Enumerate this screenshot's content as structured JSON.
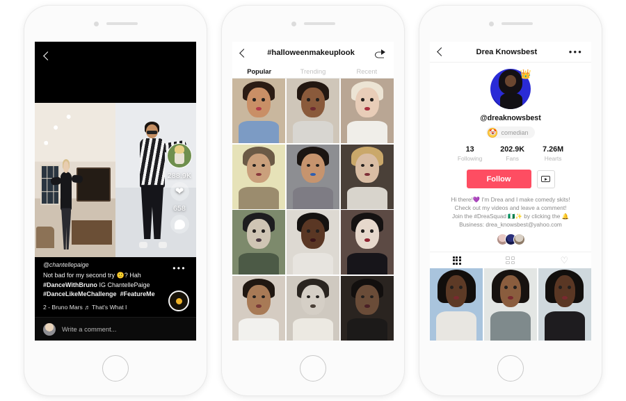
{
  "page": {
    "title": "TikTok app screens — duet video, hashtag feed, creator profile",
    "background": "#ffffff"
  },
  "colors": {
    "accent_follow": "#fe4d62",
    "text_primary": "#111111",
    "text_muted": "#b6b6b6",
    "badge_gold": "#ffd24d",
    "video_bg": "#000000"
  },
  "phone1": {
    "name": "duet-video-screen",
    "back_icon": "chevron-left-icon",
    "video": {
      "left_pane_label": "duet-left-video",
      "right_pane_label": "duet-right-video"
    },
    "rail": {
      "avatar_label": "creator-avatar",
      "likes": "288.9K",
      "like_icon": "heart-icon",
      "comments": "658",
      "comment_icon": "speech-bubble-icon"
    },
    "caption": {
      "handle": "@chantellepaige",
      "line1": "Not bad for my second try 🙂? Hah",
      "line2_tag": "#DanceWithBruno",
      "line2_rest": " IG ChantellePaige",
      "line3_tag1": "#DanceLikeMeChallenge",
      "line3_tag2": "#FeatureMe",
      "music": "2 - Bruno Mars  ♬ That's What I",
      "more_icon": "more-options-icon",
      "disc_icon": "music-disc-icon"
    },
    "comment_bar": {
      "avatar": "user-avatar",
      "placeholder": "Write a comment..."
    }
  },
  "phone2": {
    "name": "hashtag-feed-screen",
    "back_icon": "chevron-left-icon",
    "title": "#halloweenmakeuplook",
    "share_icon": "share-icon",
    "tabs": [
      {
        "label": "Popular",
        "active": true
      },
      {
        "label": "Trending",
        "active": false
      },
      {
        "label": "Recent",
        "active": false
      }
    ],
    "grid": [
      {
        "name": "clown-makeup-woman",
        "skin": "#c98f66",
        "hair": "#2b1c14",
        "body": "#7c9bc4",
        "bg": "#c9b79e",
        "mouth": "#b23a4a"
      },
      {
        "name": "bitten-hand-makeup-man",
        "skin": "#8a5a3b",
        "hair": "#221711",
        "body": "#d8d6d1",
        "bg": "#cfc6b9",
        "mouth": "#6e2a30"
      },
      {
        "name": "green-hair-clown-woman",
        "skin": "#e8cdb8",
        "hair": "#ece4d4",
        "body": "#f0eee9",
        "bg": "#b9a694",
        "mouth": "#a8303f"
      },
      {
        "name": "horn-prosthetic-makeup",
        "skin": "#caa07c",
        "hair": "#6b5a46",
        "body": "#9b8c6e",
        "bg": "#e6e2b8",
        "mouth": "#8a3a3e"
      },
      {
        "name": "blue-half-face-monster",
        "skin": "#c6946e",
        "hair": "#1b1512",
        "body": "#7e7c84",
        "bg": "#8d8e92",
        "mouth": "#2f5fb0"
      },
      {
        "name": "ghost-bride-makeup",
        "skin": "#d9bda4",
        "hair": "#caa86a",
        "body": "#d8d4cc",
        "bg": "#4a4038",
        "mouth": "#7d3038"
      },
      {
        "name": "silver-ornate-makeup",
        "skin": "#cfc5b4",
        "hair": "#1d1d1f",
        "body": "#4c5a46",
        "bg": "#7d8a6c",
        "mouth": "#4b3a42"
      },
      {
        "name": "ghost-costume-scream",
        "skin": "#5a3724",
        "hair": "#151210",
        "body": "#e7e4df",
        "bg": "#ddd9d2",
        "mouth": "#3a1418"
      },
      {
        "name": "pale-goth-lipstick",
        "skin": "#e6d8cc",
        "hair": "#151212",
        "body": "#17151a",
        "bg": "#5c4a44",
        "mouth": "#8e2230"
      },
      {
        "name": "white-circle-eye-makeup",
        "skin": "#a87a56",
        "hair": "#201711",
        "body": "#f2f1ee",
        "bg": "#d5ccc2",
        "mouth": "#7a3a38"
      },
      {
        "name": "skull-print-hoodie",
        "skin": "#d5cfc6",
        "hair": "#2a2520",
        "body": "#ece9e2",
        "bg": "#cfc9c0",
        "mouth": "#4a4038"
      },
      {
        "name": "dark-room-makeup",
        "skin": "#6a4c38",
        "hair": "#120f0e",
        "body": "#1c1a19",
        "bg": "#2a2420",
        "mouth": "#4a2026"
      }
    ]
  },
  "phone3": {
    "name": "creator-profile-screen",
    "back_icon": "chevron-left-icon",
    "title": "Drea Knowsbest",
    "more_icon": "more-options-icon",
    "avatar_label": "profile-avatar",
    "crown_icon": "👑",
    "handle": "@dreaknowsbest",
    "badge": {
      "icon": "🤡",
      "label": "comedian"
    },
    "stats": [
      {
        "value": "13",
        "label": "Following"
      },
      {
        "value": "202.9K",
        "label": "Fans"
      },
      {
        "value": "7.26M",
        "label": "Hearts"
      }
    ],
    "follow_label": "Follow",
    "youtube_icon": "play-box-icon",
    "bio": [
      "Hi there!💜 I'm Drea and I make comedy skits!",
      "Check out my videos and leave a comment!",
      "Join the #DreaSquad 🇳🇬✨ by clicking the 🔔",
      "Business: drea_knowsbest@yahoo.com"
    ],
    "friends": [
      {
        "name": "friend-avatar-1",
        "c1": "#e8c9c4",
        "c2": "#b08f86"
      },
      {
        "name": "friend-avatar-2",
        "c1": "#2a2f7a",
        "c2": "#14184a"
      },
      {
        "name": "friend-avatar-3",
        "c1": "#d8cfc4",
        "c2": "#8e7b68"
      }
    ],
    "tabs": [
      {
        "name": "tab-videos-grid",
        "icon": "grid-3x3-icon",
        "active": true
      },
      {
        "name": "tab-liked-grid",
        "icon": "grid-2x2-icon",
        "active": false
      },
      {
        "name": "tab-hearts",
        "icon": "heart-outline-icon",
        "active": false
      }
    ],
    "videos": [
      {
        "name": "video-outdoor-selfie",
        "skin": "#5d3a26",
        "hair": "#120e0c",
        "body": "#e8e6e1",
        "bg": "#a9c4dd"
      },
      {
        "name": "video-glasses-closeup",
        "skin": "#8a5d3e",
        "hair": "#17120f",
        "body": "#7f8a8c",
        "bg": "#e3e6e4"
      },
      {
        "name": "video-indoor-curly",
        "skin": "#5a3724",
        "hair": "#120f0d",
        "body": "#1e1c1f",
        "bg": "#cfd8dd"
      }
    ]
  }
}
